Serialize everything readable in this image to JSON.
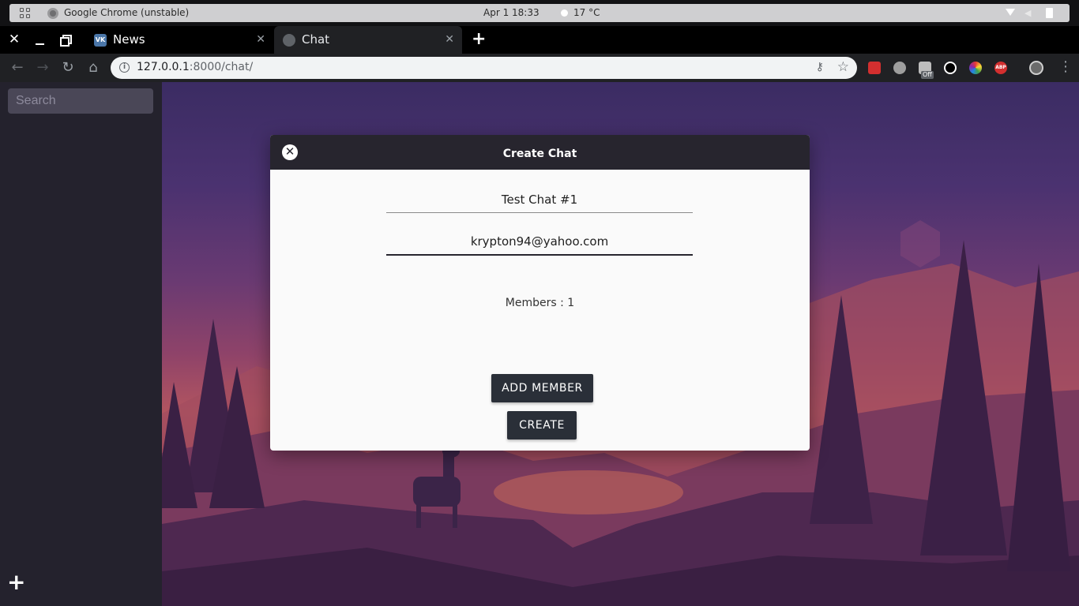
{
  "os_bar": {
    "app_title": "Google Chrome (unstable)",
    "clock": "Apr 1  18:33",
    "weather": "17 °C"
  },
  "tabs": [
    {
      "title": "News",
      "icon": "vk-icon",
      "active": false,
      "favicon_text": "VK"
    },
    {
      "title": "Chat",
      "icon": "globe-icon",
      "active": true
    }
  ],
  "tab_close_glyph": "✕",
  "new_tab_glyph": "+",
  "window_close_glyph": "✕",
  "address_bar": {
    "url_host": "127.0.0.1",
    "url_rest": ":8000/chat/"
  },
  "extensions": {
    "badge_off": "Off",
    "abp_label": "ABP"
  },
  "sidebar": {
    "search_placeholder": "Search",
    "add_glyph": "+"
  },
  "modal": {
    "title": "Create Chat",
    "close_glyph": "✕",
    "chat_name_value": "Test Chat #1",
    "member_email_value": "krypton94@yahoo.com",
    "members_label": "Members : 1",
    "add_member_label": "ADD MEMBER",
    "create_label": "CREATE"
  },
  "colors": {
    "sidebar_bg": "#24222d",
    "modal_header_bg": "#27252e",
    "button_bg": "#2a2f38",
    "search_bg": "#4a4757"
  }
}
